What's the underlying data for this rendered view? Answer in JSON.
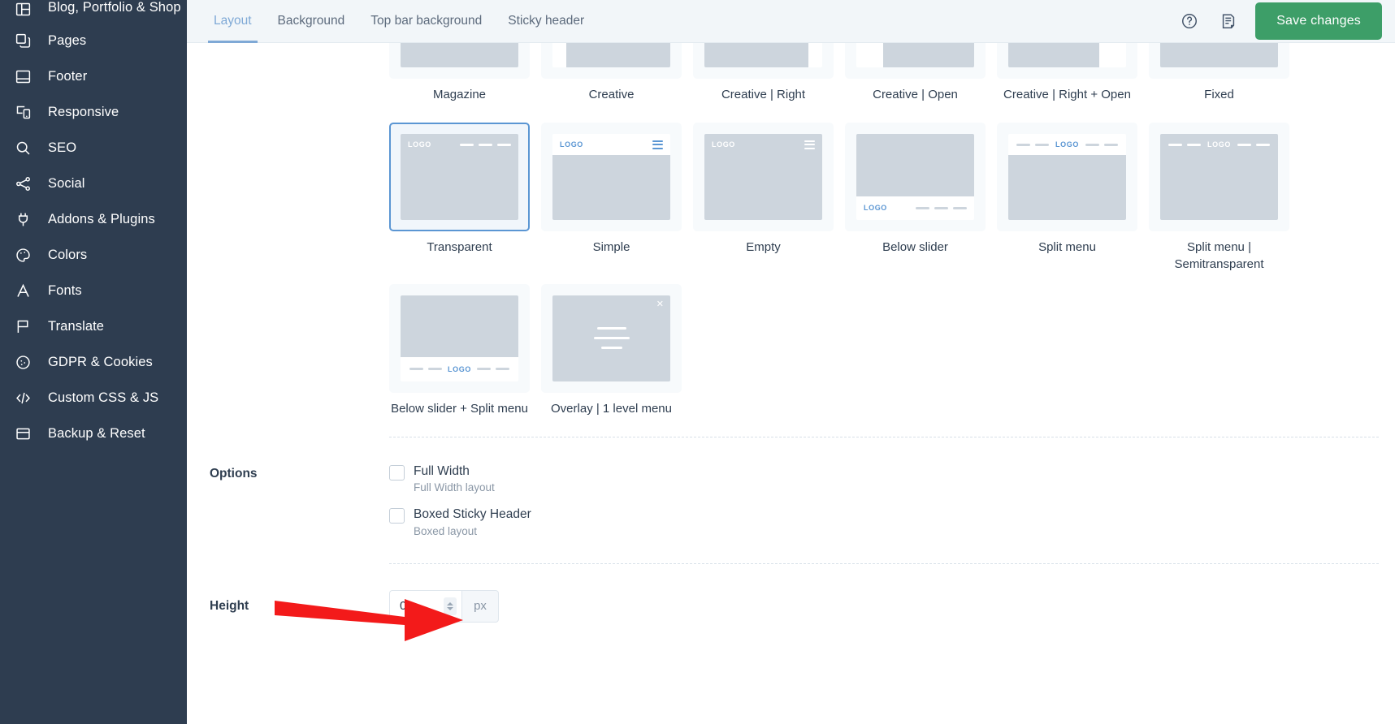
{
  "sidebar": {
    "items": [
      {
        "label": "Blog, Portfolio & Shop",
        "icon": "layout-columns-icon"
      },
      {
        "label": "Pages",
        "icon": "pages-copy-icon"
      },
      {
        "label": "Footer",
        "icon": "footer-icon"
      },
      {
        "label": "Responsive",
        "icon": "responsive-devices-icon"
      },
      {
        "label": "SEO",
        "icon": "search-icon"
      },
      {
        "label": "Social",
        "icon": "share-icon"
      },
      {
        "label": "Addons & Plugins",
        "icon": "plug-icon"
      },
      {
        "label": "Colors",
        "icon": "palette-icon"
      },
      {
        "label": "Fonts",
        "icon": "letter-a-icon"
      },
      {
        "label": "Translate",
        "icon": "flag-icon"
      },
      {
        "label": "GDPR & Cookies",
        "icon": "cookie-icon"
      },
      {
        "label": "Custom CSS & JS",
        "icon": "code-brackets-icon"
      },
      {
        "label": "Backup & Reset",
        "icon": "archive-box-icon"
      }
    ]
  },
  "topbar": {
    "tabs": [
      {
        "label": "Layout",
        "active": true
      },
      {
        "label": "Background",
        "active": false
      },
      {
        "label": "Top bar background",
        "active": false
      },
      {
        "label": "Sticky header",
        "active": false
      }
    ],
    "help_icon": "question-circle-icon",
    "notes_icon": "document-note-icon",
    "save_label": "Save changes",
    "accent_color": "#7fa9d6",
    "save_color": "#3d9e68",
    "background_color": "#f2f6f9"
  },
  "layouts": {
    "row1": [
      {
        "label": "Magazine",
        "style": "magazine",
        "selected": false
      },
      {
        "label": "Creative",
        "style": "creative",
        "selected": false
      },
      {
        "label": "Creative | Right",
        "style": "creative-right",
        "selected": false
      },
      {
        "label": "Creative | Open",
        "style": "creative-open",
        "selected": false
      },
      {
        "label": "Creative | Right + Open",
        "style": "creative-right-open",
        "selected": false
      },
      {
        "label": "Fixed",
        "style": "fixed",
        "selected": false
      }
    ],
    "row2": [
      {
        "label": "Transparent",
        "style": "transparent",
        "selected": true,
        "logo": "LOGO"
      },
      {
        "label": "Simple",
        "style": "simple",
        "selected": false,
        "logo": "LOGO"
      },
      {
        "label": "Empty",
        "style": "empty",
        "selected": false,
        "logo": "LOGO"
      },
      {
        "label": "Below slider",
        "style": "below-slider",
        "selected": false,
        "logo": "LOGO"
      },
      {
        "label": "Split menu",
        "style": "split-menu",
        "selected": false,
        "logo": "LOGO"
      },
      {
        "label": "Split menu | Semitransparent",
        "style": "split-menu-semi",
        "selected": false,
        "logo": "LOGO"
      }
    ],
    "row3": [
      {
        "label": "Below slider + Split menu",
        "style": "below-slider-split",
        "selected": false,
        "logo": "LOGO"
      },
      {
        "label": "Overlay | 1 level menu",
        "style": "overlay-1-level",
        "selected": false,
        "logo": ""
      }
    ]
  },
  "options_row": {
    "label": "Options",
    "items": [
      {
        "title": "Full Width",
        "subtitle": "Full Width layout",
        "checked": false
      },
      {
        "title": "Boxed Sticky Header",
        "subtitle": "Boxed layout",
        "checked": false
      }
    ]
  },
  "height_row": {
    "label": "Height",
    "value": "0",
    "unit": "px",
    "annotation": {
      "type": "red-arrow",
      "color": "#f31a1a",
      "points_to": "height-input"
    }
  }
}
